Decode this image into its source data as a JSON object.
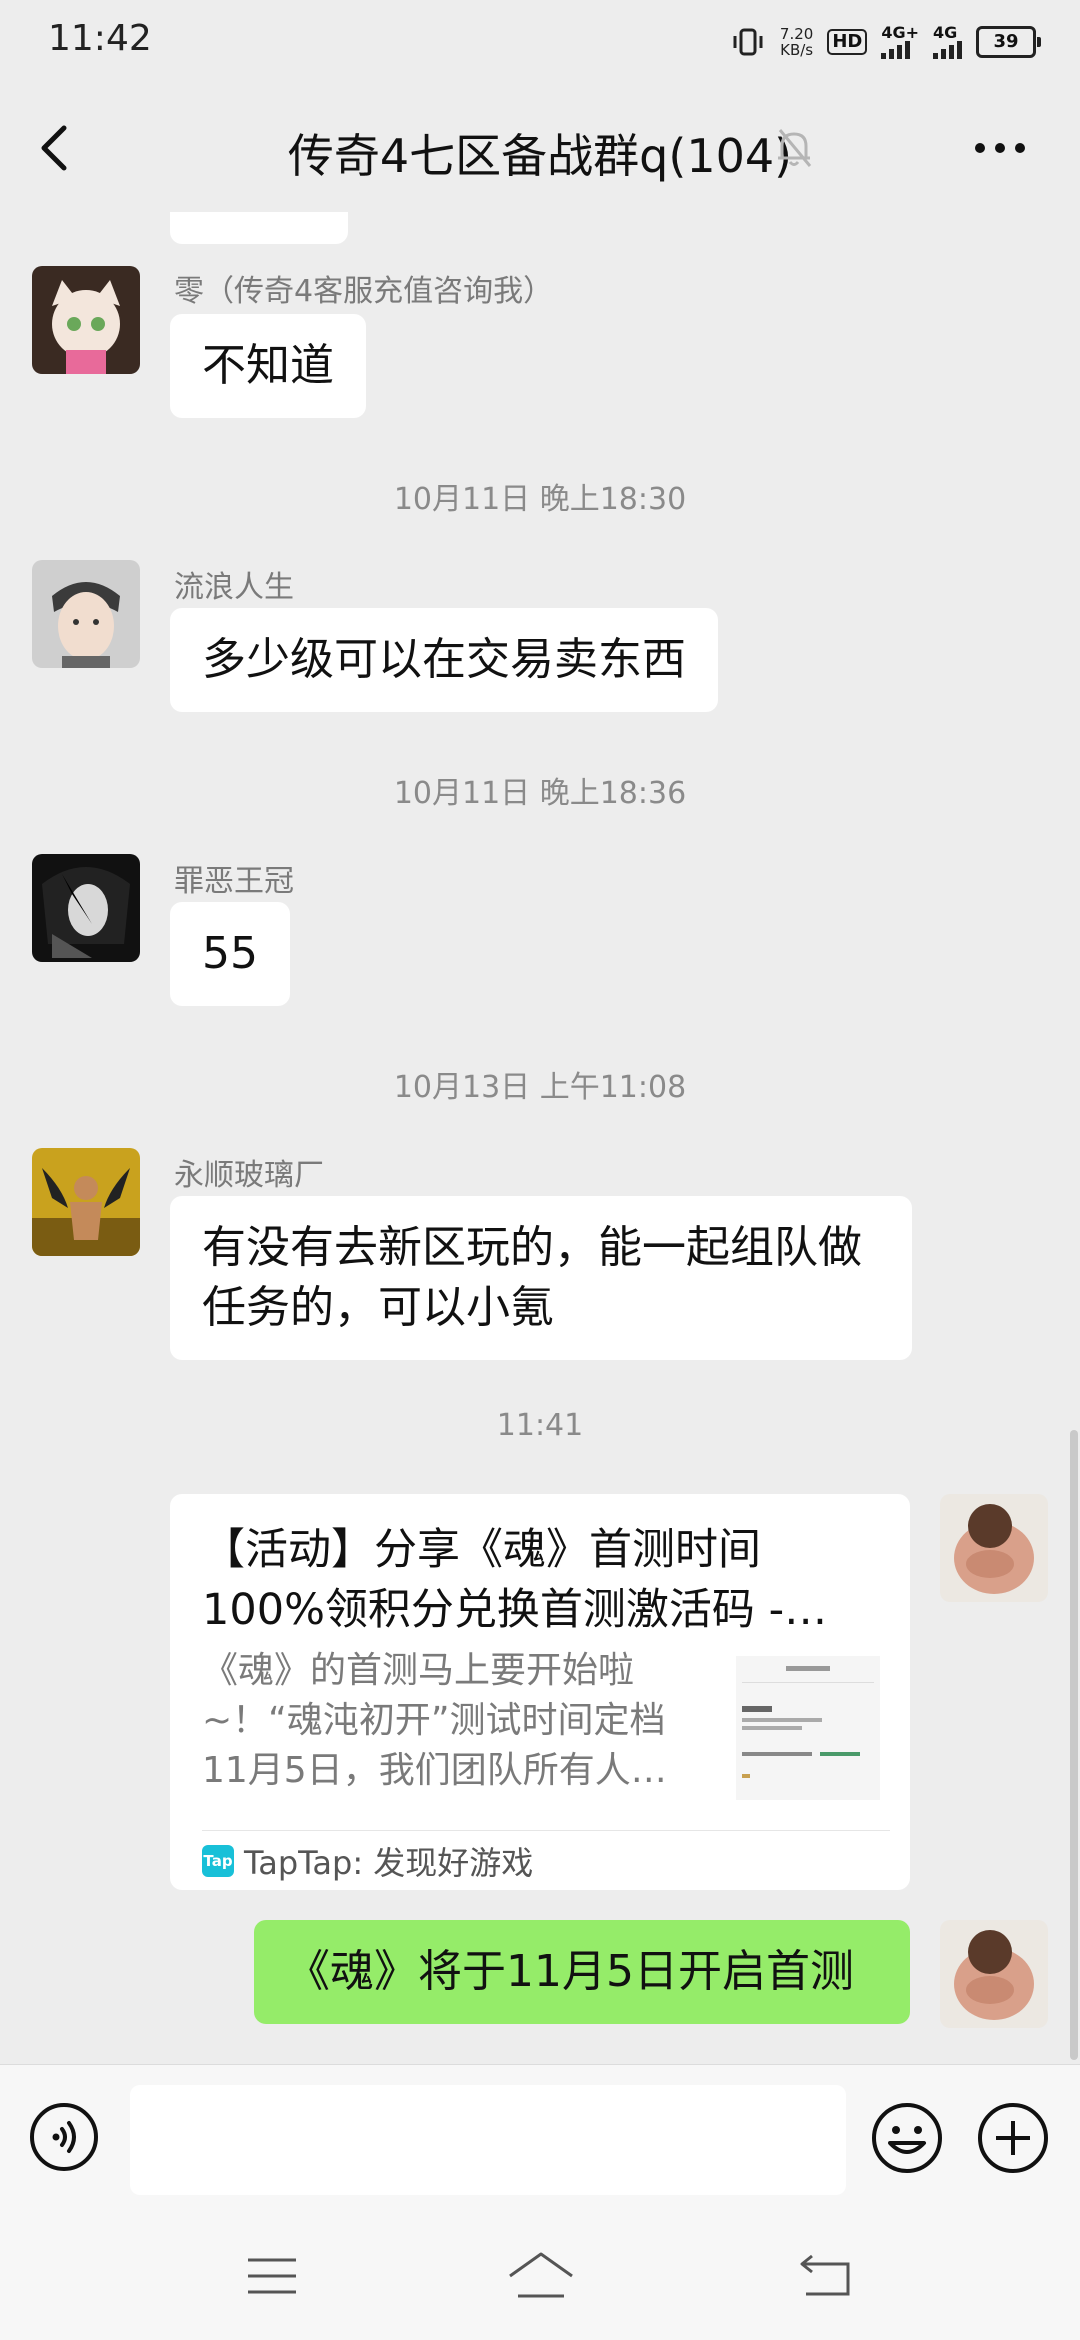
{
  "status_bar": {
    "time": "11:42",
    "speed_value": "7.20",
    "speed_unit": "KB/s",
    "hd": "HD",
    "sim1_label": "4G+",
    "sim2_label": "4G",
    "battery": "39"
  },
  "header": {
    "title": "传奇4七区备战群q(104)",
    "back_icon": "chevron-left-icon",
    "mute_icon": "bell-off-icon",
    "more_icon": "more-dots-icon"
  },
  "messages": [
    {
      "sender": "零（传奇4客服充值咨询我）",
      "text": "不知道"
    },
    {
      "time": "10月11日 晚上18:30"
    },
    {
      "sender": "流浪人生",
      "text": "多少级可以在交易卖东西"
    },
    {
      "time": "10月11日 晚上18:36"
    },
    {
      "sender": "罪恶王冠",
      "text": "55"
    },
    {
      "time": "10月13日 上午11:08"
    },
    {
      "sender": "永顺玻璃厂",
      "text": "有没有去新区玩的，能一起组队做任务的，可以小氪"
    },
    {
      "time": "11:41"
    },
    {
      "card_title": "【活动】分享《魂》首测时间100%领积分兑换首测激活码 -…",
      "card_desc": "《魂》的首测马上要开始啦~！“魂沌初开”测试时间定档11月5日，我们团队所有人…",
      "card_source": "TapTap: 发现好游戏",
      "card_logo": "Tap",
      "from_me": true
    },
    {
      "text": "《魂》将于11月5日开启首测",
      "from_me": true
    }
  ],
  "input_bar": {
    "voice_icon": "voice-icon",
    "placeholder": "",
    "emoji_icon": "emoji-icon",
    "plus_icon": "plus-circle-icon"
  },
  "colors": {
    "background": "#ededed",
    "my_bubble": "#95ec69",
    "other_bubble": "#ffffff"
  }
}
